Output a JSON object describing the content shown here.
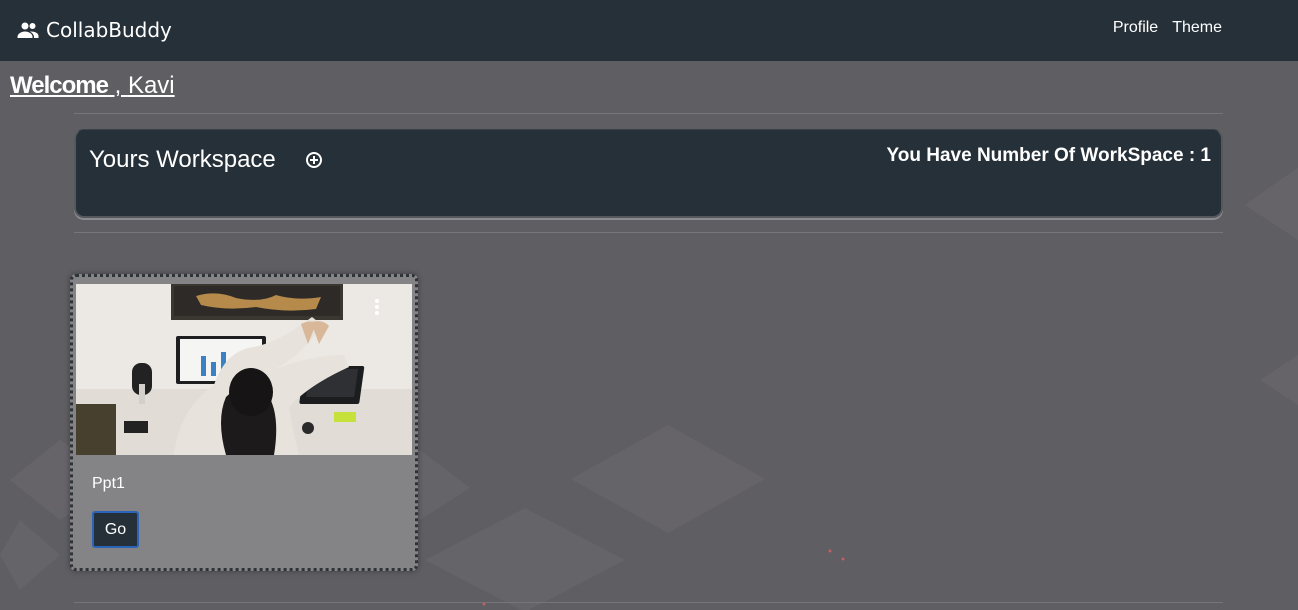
{
  "navbar": {
    "brand": "CollabBuddy",
    "brand_icon": "people-icon",
    "links": [
      "Profile",
      "Theme"
    ]
  },
  "welcome": {
    "greeting": "Welcome",
    "separator": " , ",
    "name": "Kavi"
  },
  "workspace_header": {
    "title": "Yours Workspace",
    "add_icon": "add-circle-icon",
    "count_text": "You Have Number Of WorkSpace : 1"
  },
  "workspaces": [
    {
      "name": "Ppt1",
      "button": "Go",
      "menu_icon": "more-vertical-icon",
      "image": "woman-stretching-at-desk-photo"
    }
  ],
  "colors": {
    "navbar": "#263038",
    "background": "#5f5e63",
    "card": "#848385",
    "button_border": "#2a64b8"
  }
}
